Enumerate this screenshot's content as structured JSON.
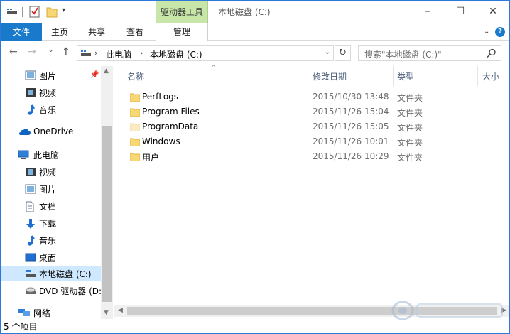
{
  "title_bar": {
    "context_tab_header": "驱动器工具",
    "window_title": "本地磁盘 (C:)",
    "minimize": "–",
    "maximize": "☐",
    "close": "✕"
  },
  "ribbon": {
    "file_tab": "文件",
    "tabs": [
      "主页",
      "共享",
      "查看"
    ],
    "manage_tab": "管理",
    "expand_icon": "chevron-down-icon",
    "help_icon": "?"
  },
  "nav": {
    "back": "←",
    "forward": "→",
    "recent": "⌄",
    "up": "↑",
    "breadcrumb": [
      "此电脑",
      "本地磁盘 (C:)"
    ],
    "refresh": "↻",
    "search_placeholder": "搜索\"本地磁盘 (C:)\""
  },
  "nav_pane": {
    "items": [
      {
        "label": "图片",
        "icon": "pictures-icon"
      },
      {
        "label": "视频",
        "icon": "videos-icon"
      },
      {
        "label": "音乐",
        "icon": "music-icon"
      },
      {
        "label": "OneDrive",
        "icon": "onedrive-icon"
      },
      {
        "label": "此电脑",
        "icon": "this-pc-icon"
      },
      {
        "label": "视频",
        "icon": "videos-icon"
      },
      {
        "label": "图片",
        "icon": "pictures-icon"
      },
      {
        "label": "文档",
        "icon": "documents-icon"
      },
      {
        "label": "下载",
        "icon": "downloads-icon"
      },
      {
        "label": "音乐",
        "icon": "music-icon"
      },
      {
        "label": "桌面",
        "icon": "desktop-icon"
      },
      {
        "label": "本地磁盘 (C:)",
        "icon": "local-disk-icon",
        "selected": true
      },
      {
        "label": "DVD 驱动器 (D:",
        "icon": "dvd-drive-icon"
      },
      {
        "label": "网络",
        "icon": "network-icon"
      }
    ]
  },
  "file_list": {
    "columns": [
      "名称",
      "修改日期",
      "类型",
      "大小"
    ],
    "rows": [
      {
        "name": "PerfLogs",
        "modified": "2015/10/30 13:48",
        "type": "文件夹"
      },
      {
        "name": "Program Files",
        "modified": "2015/11/26 15:04",
        "type": "文件夹"
      },
      {
        "name": "ProgramData",
        "modified": "2015/11/26 15:05",
        "type": "文件夹",
        "hidden": true
      },
      {
        "name": "Windows",
        "modified": "2015/11/26 10:01",
        "type": "文件夹"
      },
      {
        "name": "用户",
        "modified": "2015/11/26 10:29",
        "type": "文件夹"
      }
    ]
  },
  "status_bar": {
    "item_count": "5 个项目"
  },
  "colors": {
    "accent": "#1979ca",
    "context_tab": "#c8e6a8",
    "selection": "#cde8ff",
    "folder": "#f8d775"
  }
}
